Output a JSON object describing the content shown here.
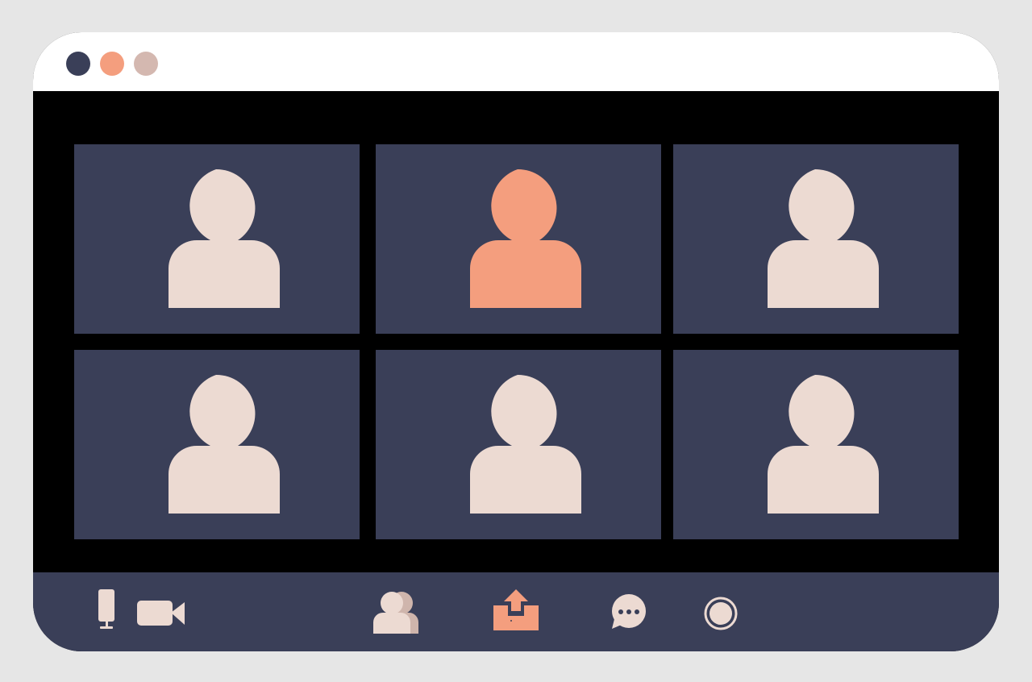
{
  "window": {
    "controls": [
      {
        "name": "window-control-1",
        "color": "#3a3f58"
      },
      {
        "name": "window-control-2",
        "color": "#f49e7e"
      },
      {
        "name": "window-control-3",
        "color": "#d4b8b0"
      }
    ]
  },
  "participants": [
    {
      "id": 1,
      "avatar_color": "#ecdad2",
      "active_speaker": false
    },
    {
      "id": 2,
      "avatar_color": "#f49e7e",
      "active_speaker": true
    },
    {
      "id": 3,
      "avatar_color": "#ecdad2",
      "active_speaker": false
    },
    {
      "id": 4,
      "avatar_color": "#ecdad2",
      "active_speaker": false
    },
    {
      "id": 5,
      "avatar_color": "#ecdad2",
      "active_speaker": false
    },
    {
      "id": 6,
      "avatar_color": "#ecdad2",
      "active_speaker": false
    }
  ],
  "toolbar": {
    "buttons": [
      {
        "name": "microphone-button",
        "icon": "microphone-icon",
        "color": "#ecdad2"
      },
      {
        "name": "camera-button",
        "icon": "video-camera-icon",
        "color": "#ecdad2"
      },
      {
        "name": "participants-button",
        "icon": "participants-icon",
        "color": "#ecdad2"
      },
      {
        "name": "share-screen-button",
        "icon": "share-screen-icon",
        "color": "#f49e7e"
      },
      {
        "name": "chat-button",
        "icon": "chat-bubble-icon",
        "color": "#ecdad2"
      },
      {
        "name": "record-button",
        "icon": "record-icon",
        "color": "#ecdad2"
      }
    ]
  },
  "colors": {
    "page_background": "#e6e6e6",
    "titlebar": "#ffffff",
    "video_background": "#000000",
    "tile_background": "#3a3f58",
    "toolbar_background": "#3a3f58",
    "accent": "#f49e7e",
    "avatar_default": "#ecdad2"
  }
}
